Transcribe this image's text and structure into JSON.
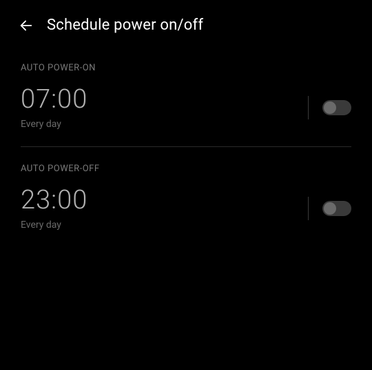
{
  "header": {
    "title": "Schedule power on/off"
  },
  "power_on": {
    "label": "AUTO POWER-ON",
    "time": "07:00",
    "repeat": "Every day",
    "enabled": false
  },
  "power_off": {
    "label": "AUTO POWER-OFF",
    "time": "23:00",
    "repeat": "Every day",
    "enabled": false
  }
}
